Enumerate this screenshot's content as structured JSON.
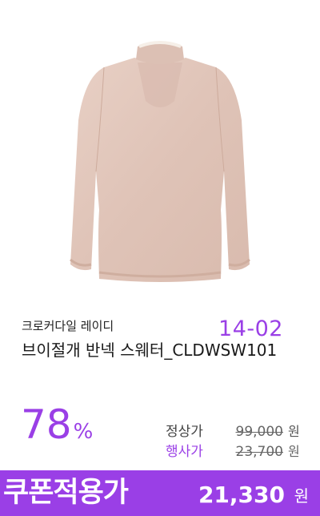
{
  "product": {
    "image": "pink-knit-sweater",
    "item_code": "14-02",
    "brand": "크로커다일 레이디",
    "name": "브이절개 반넥 스웨터_CLDWSW101"
  },
  "pricing": {
    "discount_number": "78",
    "discount_unit": "%",
    "regular_label": "정상가",
    "regular_price": "99,000",
    "sale_label": "행사가",
    "sale_price": "23,700",
    "currency": "원"
  },
  "coupon": {
    "label": "쿠폰적용가",
    "price": "21,330",
    "currency": "원"
  },
  "colors": {
    "accent": "#9a3fe6",
    "sweater": "#e3c9bd"
  }
}
